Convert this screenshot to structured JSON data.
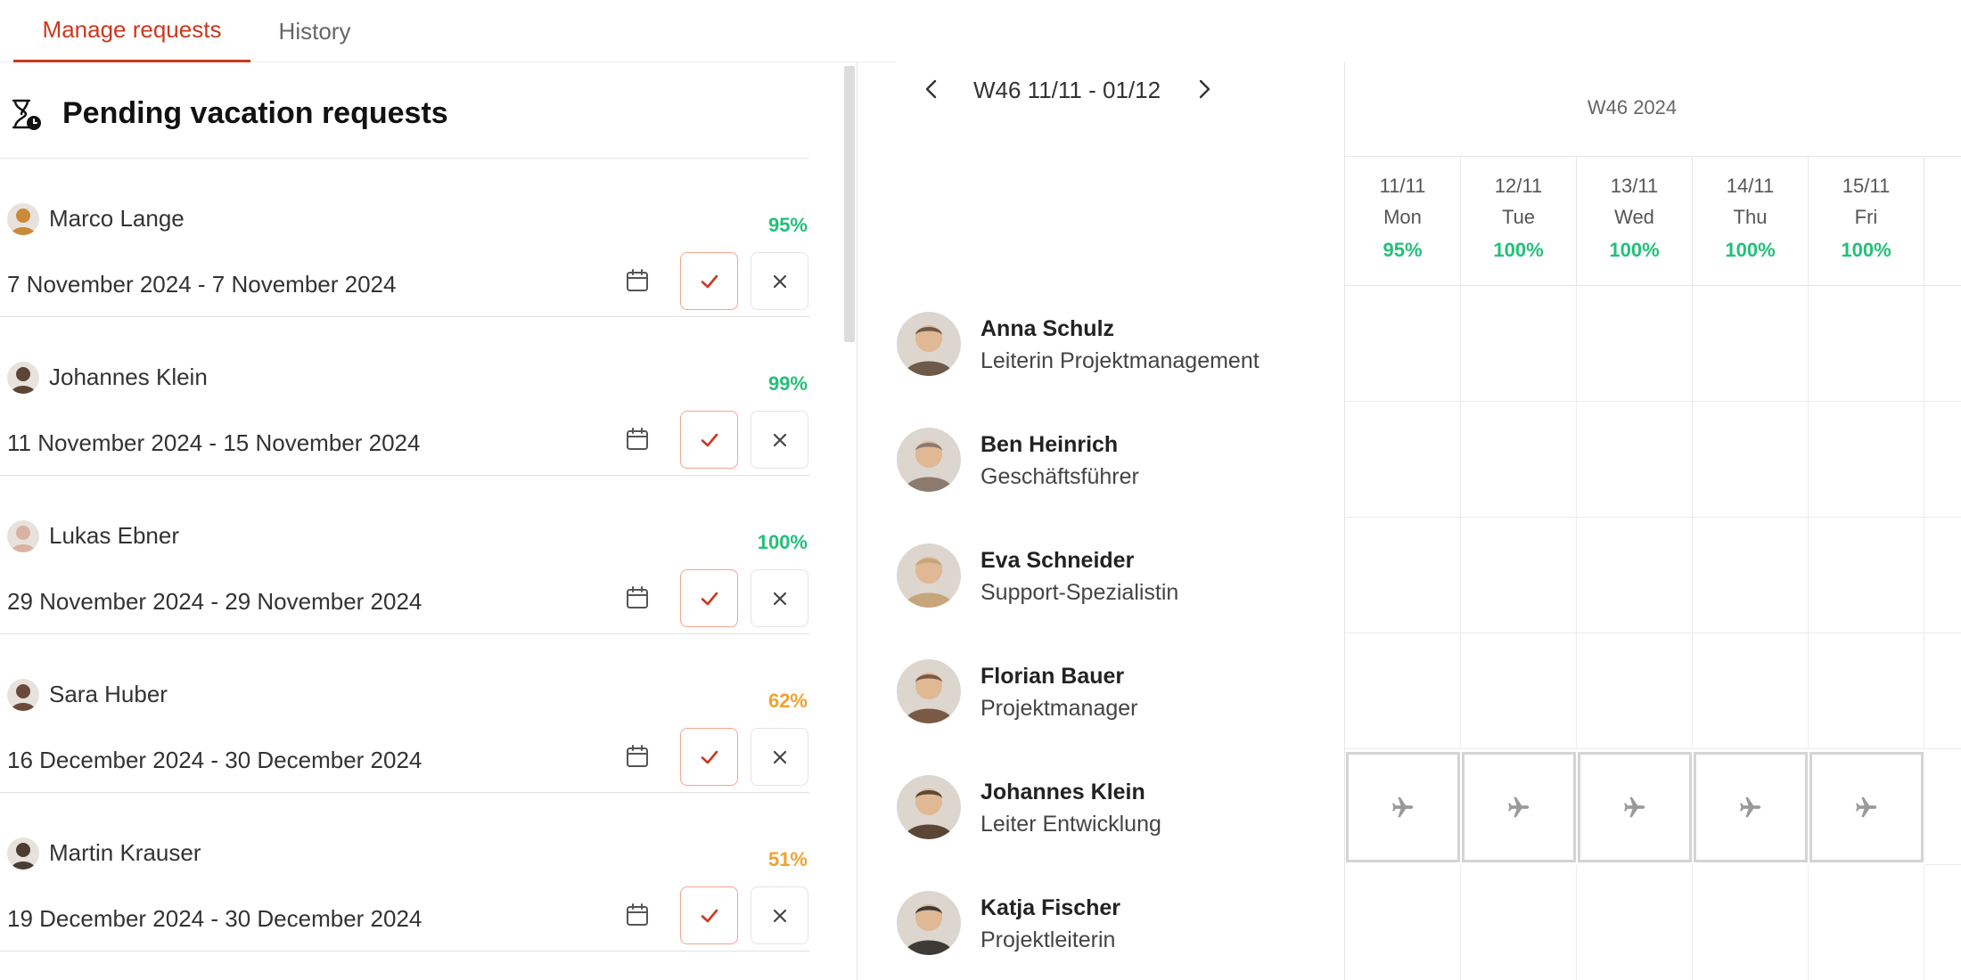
{
  "tabs": {
    "manage": "Manage requests",
    "history": "History"
  },
  "pending": {
    "title": "Pending vacation requests",
    "requests": [
      {
        "name": "Marco Lange",
        "pct": "95%",
        "pct_color": "#22c07a",
        "dates": "7 November 2024 - 7 November 2024",
        "avatar_color": "#c98a3a"
      },
      {
        "name": "Johannes Klein",
        "pct": "99%",
        "pct_color": "#22c07a",
        "dates": "11 November 2024 - 15 November 2024",
        "avatar_color": "#5b4636"
      },
      {
        "name": "Lukas Ebner",
        "pct": "100%",
        "pct_color": "#22c07a",
        "dates": "29 November 2024 - 29 November 2024",
        "avatar_color": "#d9b3a0"
      },
      {
        "name": "Sara Huber",
        "pct": "62%",
        "pct_color": "#f0a22e",
        "dates": "16 December 2024 - 30 December 2024",
        "avatar_color": "#6b4a3a"
      },
      {
        "name": "Martin Krauser",
        "pct": "51%",
        "pct_color": "#f0a22e",
        "dates": "19 December 2024 - 30 December 2024",
        "avatar_color": "#4c3c32"
      }
    ]
  },
  "calendar": {
    "week_label": "W46 11/11 - 01/12",
    "week_year": "W46 2024",
    "days": [
      {
        "date": "11/11",
        "weekday": "Mon",
        "pct": "95%"
      },
      {
        "date": "12/11",
        "weekday": "Tue",
        "pct": "100%"
      },
      {
        "date": "13/11",
        "weekday": "Wed",
        "pct": "100%"
      },
      {
        "date": "14/11",
        "weekday": "Thu",
        "pct": "100%"
      },
      {
        "date": "15/11",
        "weekday": "Fri",
        "pct": "100%"
      }
    ],
    "employees": [
      {
        "name": "Anna Schulz",
        "role": "Leiterin Projektmanagement",
        "avatar_color": "#6d5a4a",
        "vacation": false
      },
      {
        "name": "Ben Heinrich",
        "role": "Geschäftsführer",
        "avatar_color": "#8c7a6e",
        "vacation": false
      },
      {
        "name": "Eva Schneider",
        "role": "Support-Spezialistin",
        "avatar_color": "#c7a57a",
        "vacation": false
      },
      {
        "name": "Florian Bauer",
        "role": "Projektmanager",
        "avatar_color": "#7a5a45",
        "vacation": false
      },
      {
        "name": "Johannes Klein",
        "role": "Leiter Entwicklung",
        "avatar_color": "#5b4636",
        "vacation": true
      },
      {
        "name": "Katja Fischer",
        "role": "Projektleiterin",
        "avatar_color": "#3e3a36",
        "vacation": false
      }
    ]
  },
  "colors": {
    "accent": "#c9391f",
    "ok": "#22c07a",
    "warn": "#f0a22e"
  }
}
